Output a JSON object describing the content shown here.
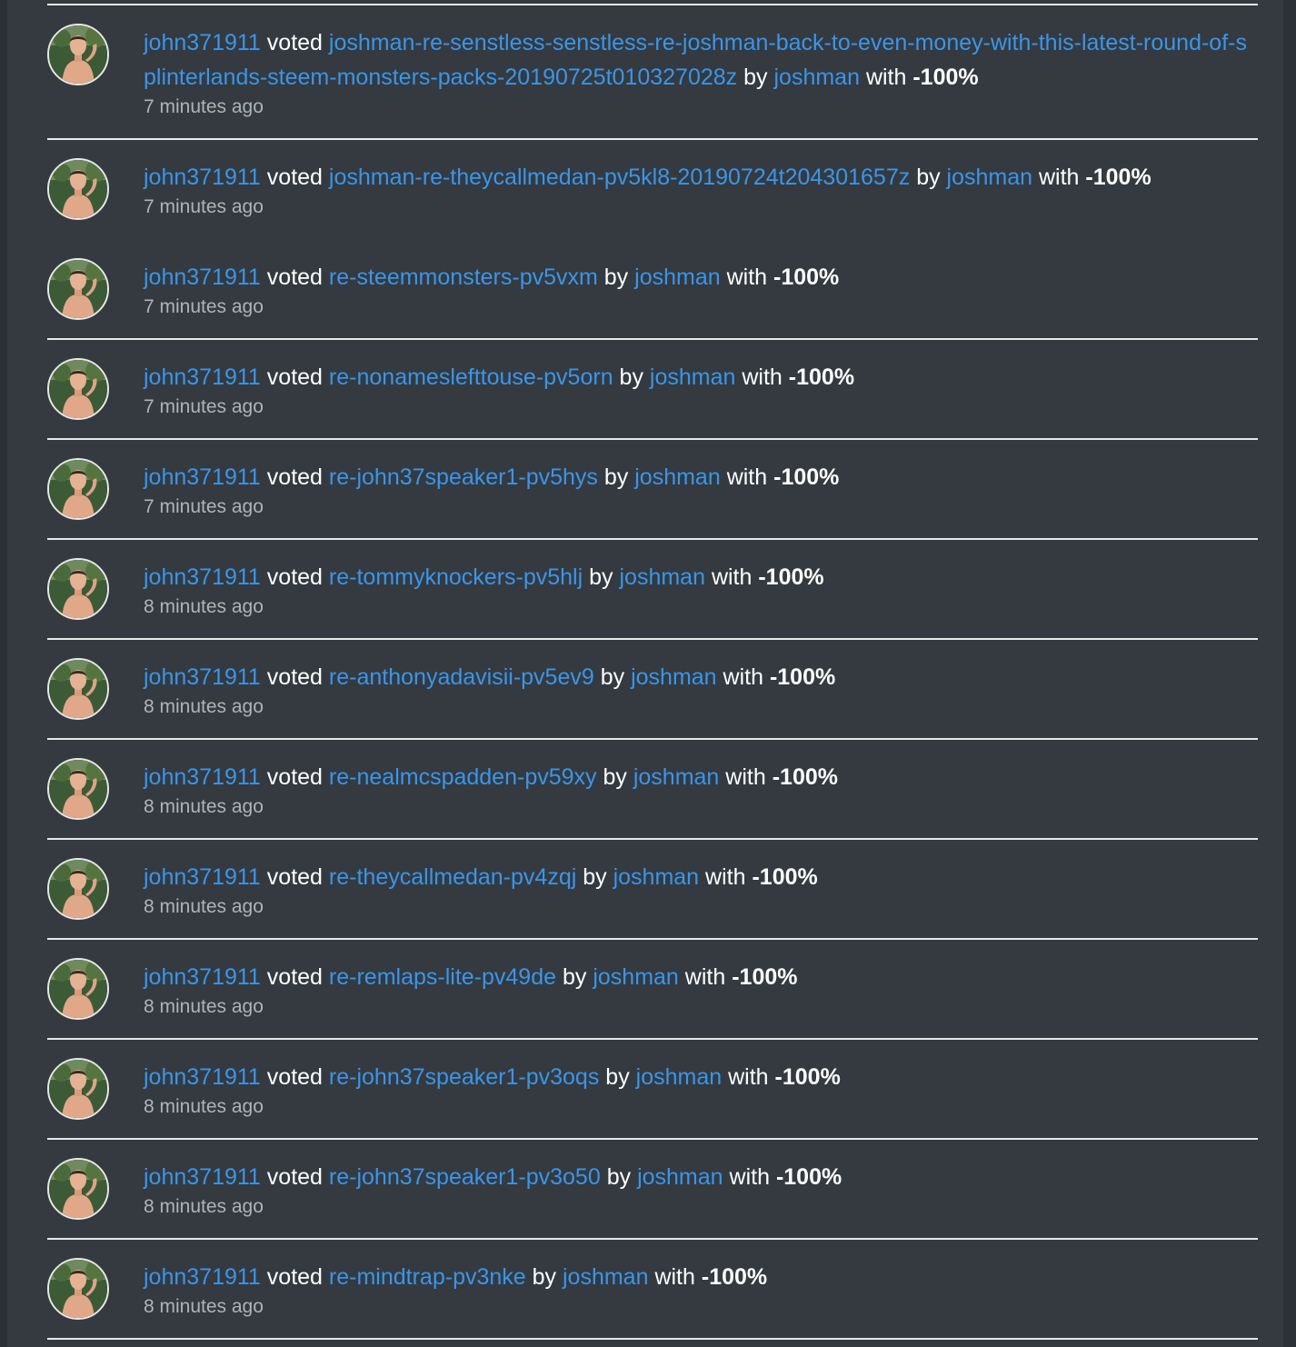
{
  "colors": {
    "background": "#2c3136",
    "panel": "#343a40",
    "link": "#3b95e8",
    "text": "#ffffff",
    "muted": "#aeb3b8",
    "divider": "#e8e8e8"
  },
  "icons": {
    "avatar": "user-avatar-photo"
  },
  "words": {
    "voted": "voted",
    "by": "by",
    "with": "with"
  },
  "activities": [
    {
      "voter": "john371911",
      "permlink": "joshman-re-senstless-senstless-re-joshman-back-to-even-money-with-this-latest-round-of-splinterlands-steem-monsters-packs-20190725t010327028z",
      "author": "joshman",
      "weight": "-100%",
      "time": "7 minutes ago"
    },
    {
      "voter": "john371911",
      "permlink": "joshman-re-theycallmedan-pv5kl8-20190724t204301657z",
      "author": "joshman",
      "weight": "-100%",
      "time": "7 minutes ago"
    },
    {
      "voter": "john371911",
      "permlink": "re-steemmonsters-pv5vxm",
      "author": "joshman",
      "weight": "-100%",
      "time": "7 minutes ago"
    },
    {
      "voter": "john371911",
      "permlink": "re-nonameslefttouse-pv5orn",
      "author": "joshman",
      "weight": "-100%",
      "time": "7 minutes ago"
    },
    {
      "voter": "john371911",
      "permlink": "re-john37speaker1-pv5hys",
      "author": "joshman",
      "weight": "-100%",
      "time": "7 minutes ago"
    },
    {
      "voter": "john371911",
      "permlink": "re-tommyknockers-pv5hlj",
      "author": "joshman",
      "weight": "-100%",
      "time": "8 minutes ago"
    },
    {
      "voter": "john371911",
      "permlink": "re-anthonyadavisii-pv5ev9",
      "author": "joshman",
      "weight": "-100%",
      "time": "8 minutes ago"
    },
    {
      "voter": "john371911",
      "permlink": "re-nealmcspadden-pv59xy",
      "author": "joshman",
      "weight": "-100%",
      "time": "8 minutes ago"
    },
    {
      "voter": "john371911",
      "permlink": "re-theycallmedan-pv4zqj",
      "author": "joshman",
      "weight": "-100%",
      "time": "8 minutes ago"
    },
    {
      "voter": "john371911",
      "permlink": "re-remlaps-lite-pv49de",
      "author": "joshman",
      "weight": "-100%",
      "time": "8 minutes ago"
    },
    {
      "voter": "john371911",
      "permlink": "re-john37speaker1-pv3oqs",
      "author": "joshman",
      "weight": "-100%",
      "time": "8 minutes ago"
    },
    {
      "voter": "john371911",
      "permlink": "re-john37speaker1-pv3o50",
      "author": "joshman",
      "weight": "-100%",
      "time": "8 minutes ago"
    },
    {
      "voter": "john371911",
      "permlink": "re-mindtrap-pv3nke",
      "author": "joshman",
      "weight": "-100%",
      "time": "8 minutes ago"
    }
  ]
}
